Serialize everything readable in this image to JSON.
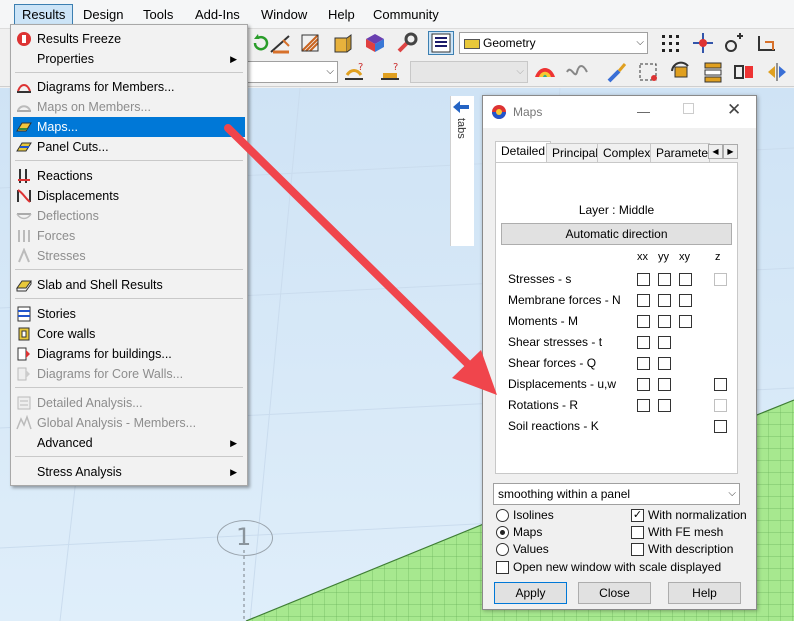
{
  "menubar": {
    "items": [
      "Results",
      "Design",
      "Tools",
      "Add-Ins",
      "Window",
      "Help",
      "Community"
    ]
  },
  "toolbar": {
    "geometry_combo": "Geometry",
    "empty_combo": "",
    "disabled_combo": ""
  },
  "results_menu": {
    "items": [
      {
        "label": "Results Freeze",
        "icon": "freeze-icon",
        "enabled": true
      },
      {
        "label": "Properties",
        "icon": "",
        "enabled": true,
        "submenu": true
      },
      {
        "label": "Diagrams for Members...",
        "icon": "diagram-members-icon",
        "enabled": true
      },
      {
        "label": "Maps on Members...",
        "icon": "maps-members-icon",
        "enabled": false
      },
      {
        "label": "Maps...",
        "icon": "maps-icon",
        "enabled": true,
        "selected": true
      },
      {
        "label": "Panel Cuts...",
        "icon": "panel-cuts-icon",
        "enabled": true
      },
      {
        "label": "Reactions",
        "icon": "reactions-icon",
        "enabled": true
      },
      {
        "label": "Displacements",
        "icon": "displacements-icon",
        "enabled": true
      },
      {
        "label": "Deflections",
        "icon": "deflections-icon",
        "enabled": false
      },
      {
        "label": "Forces",
        "icon": "forces-icon",
        "enabled": false
      },
      {
        "label": "Stresses",
        "icon": "stresses-icon",
        "enabled": false
      },
      {
        "label": "Slab and Shell Results",
        "icon": "slab-shell-icon",
        "enabled": true
      },
      {
        "label": "Stories",
        "icon": "stories-icon",
        "enabled": true
      },
      {
        "label": "Core walls",
        "icon": "core-walls-icon",
        "enabled": true
      },
      {
        "label": "Diagrams for buildings...",
        "icon": "diagram-buildings-icon",
        "enabled": true
      },
      {
        "label": "Diagrams for Core Walls...",
        "icon": "diagram-core-walls-icon",
        "enabled": false
      },
      {
        "label": "Detailed Analysis...",
        "icon": "detailed-analysis-icon",
        "enabled": false
      },
      {
        "label": "Global Analysis - Members...",
        "icon": "global-analysis-icon",
        "enabled": false
      },
      {
        "label": "Advanced",
        "icon": "",
        "enabled": true,
        "submenu": true
      },
      {
        "label": "Stress Analysis",
        "icon": "",
        "enabled": true,
        "submenu": true
      }
    ]
  },
  "workspace": {
    "tabs_label": "tabs",
    "axis_label": "1"
  },
  "maps_dialog": {
    "title": "Maps",
    "tabs": [
      "Detailed",
      "Principal",
      "Complex",
      "Parameter"
    ],
    "layer_text": "Layer : Middle",
    "auto_direction_label": "Automatic direction",
    "columns": [
      "xx",
      "yy",
      "xy",
      "z"
    ],
    "rows": [
      {
        "label": "Stresses - s",
        "xx": true,
        "yy": true,
        "xy": true,
        "z": "disabled"
      },
      {
        "label": "Membrane forces - N",
        "xx": true,
        "yy": true,
        "xy": true,
        "z": null
      },
      {
        "label": "Moments - M",
        "xx": true,
        "yy": true,
        "xy": true,
        "z": null
      },
      {
        "label": "Shear stresses - t",
        "xx": true,
        "yy": true,
        "xy": false,
        "z": null
      },
      {
        "label": "Shear forces - Q",
        "xx": true,
        "yy": true,
        "xy": false,
        "z": null
      },
      {
        "label": "Displacements - u,w",
        "xx": true,
        "yy": true,
        "xy": false,
        "z": "enabled"
      },
      {
        "label": "Rotations - R",
        "xx": true,
        "yy": true,
        "xy": false,
        "z": "disabled"
      },
      {
        "label": "Soil reactions - K",
        "xx": false,
        "yy": false,
        "xy": false,
        "z": "enabled"
      }
    ],
    "smoothing_value": "smoothing within a panel",
    "display_options": [
      {
        "label": "Isolines",
        "selected": false
      },
      {
        "label": "Maps",
        "selected": true
      },
      {
        "label": "Values",
        "selected": false
      }
    ],
    "check_options": [
      {
        "label": "With normalization",
        "checked": true
      },
      {
        "label": "With FE mesh",
        "checked": false
      },
      {
        "label": "With description",
        "checked": false
      }
    ],
    "new_window_label": "Open new window with scale displayed",
    "buttons": {
      "apply": "Apply",
      "close": "Close",
      "help": "Help"
    }
  },
  "colors": {
    "menu_highlight": "#0078d7",
    "workspace_bg": "#dbeaf7",
    "panel_green": "#a7e88f",
    "arrow_red": "#f0454c"
  }
}
